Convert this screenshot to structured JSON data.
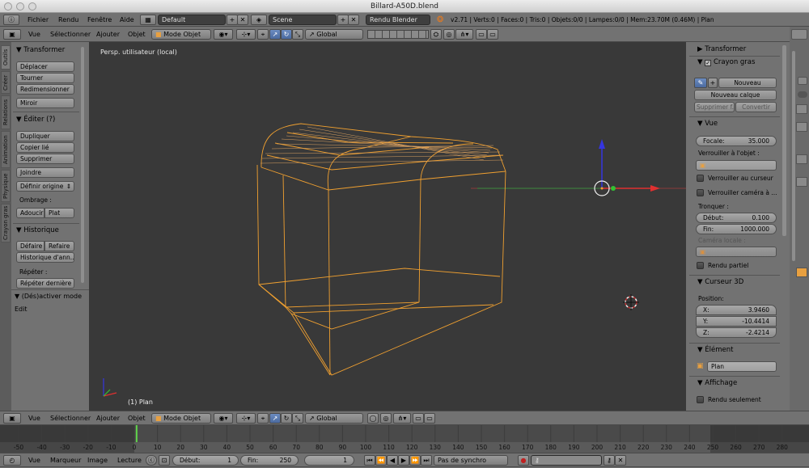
{
  "window": {
    "title": "Billard-A50D.blend"
  },
  "info_bar": {
    "menus": [
      "Fichier",
      "Rendu",
      "Fenêtre",
      "Aide"
    ],
    "layout": "Default",
    "scene": "Scene",
    "engine": "Rendu Blender",
    "stats": "v2.71 | Verts:0 | Faces:0 | Tris:0 | Objets:0/0 | Lampes:0/0 | Mem:23.70M (0.46M) | Plan"
  },
  "view_header": {
    "menus": [
      "Vue",
      "Sélectionner",
      "Ajouter",
      "Objet"
    ],
    "mode": "Mode Objet",
    "orientation": "Global"
  },
  "left_tabs": [
    "Outils",
    "Créer",
    "Relations",
    "Animation",
    "Physique",
    "Crayon gras"
  ],
  "tool_shelf": {
    "transform": {
      "title": "Transformer",
      "buttons": [
        "Déplacer",
        "Tourner",
        "Redimensionner",
        "Miroir"
      ]
    },
    "edit": {
      "title": "Éditer (?)",
      "buttons": [
        "Dupliquer",
        "Copier lié",
        "Supprimer",
        "Joindre"
      ],
      "origin": "Définir origine",
      "shading_label": "Ombrage :",
      "smooth": "Adoucir",
      "flat": "Plat"
    },
    "history": {
      "title": "Historique",
      "undo": "Défaire",
      "redo": "Refaire",
      "history_btn": "Historique d'ann...",
      "repeat_label": "Répéter :",
      "repeat_last": "Répéter dernière"
    },
    "operator": "(Dés)activer mode Edit"
  },
  "viewport": {
    "label": "Persp. utilisateur (local)",
    "object": "(1) Plan"
  },
  "properties": {
    "transform": "Transformer",
    "grease": {
      "title": "Crayon gras",
      "new": "Nouveau",
      "new_layer": "Nouveau calque",
      "delete": "Supprimer f...",
      "convert": "Convertir"
    },
    "view": {
      "title": "Vue",
      "focal_label": "Focale:",
      "focal_value": "35.000",
      "lock_label": "Verrouiller à l'objet :",
      "lock_cursor": "Verrouiller au curseur",
      "lock_camera": "Verrouiller caméra à ...",
      "clip_label": "Tronquer :",
      "start_label": "Début:",
      "start_value": "0.100",
      "end_label": "Fin:",
      "end_value": "1000.000",
      "local_camera": "Caméra locale :",
      "partial": "Rendu partiel"
    },
    "cursor": {
      "title": "Curseur 3D",
      "position": "Position:",
      "x_label": "X:",
      "x_value": "3.9460",
      "y_label": "Y:",
      "y_value": "-10.4414",
      "z_label": "Z:",
      "z_value": "-2.4214"
    },
    "element": {
      "title": "Élément",
      "name": "Plan"
    },
    "display": {
      "title": "Affichage",
      "only_render": "Rendu seulement"
    }
  },
  "timeline": {
    "ticks": [
      -50,
      -40,
      -30,
      -20,
      -10,
      0,
      10,
      20,
      30,
      40,
      50,
      60,
      70,
      80,
      90,
      100,
      110,
      120,
      130,
      140,
      150,
      160,
      170,
      180,
      190,
      200,
      210,
      220,
      230,
      240,
      250,
      260,
      270,
      280
    ],
    "current_frame": 1,
    "menus": [
      "Vue",
      "Marqueur",
      "Image",
      "Lecture"
    ],
    "start_label": "Début:",
    "start_value": "1",
    "end_label": "Fin:",
    "end_value": "250",
    "current_value": "1",
    "sync": "Pas de synchro"
  }
}
